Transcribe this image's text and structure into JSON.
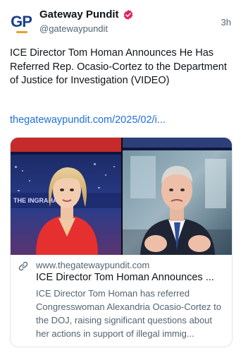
{
  "post": {
    "avatar_text": "GP",
    "display_name": "Gateway Pundit",
    "handle": "@gatewaypundit",
    "time": "3h",
    "text": "ICE Director Tom Homan Announces He Has Referred Rep. Ocasio-Cortez to the Department of Justice for Investigation (VIDEO)",
    "link": "thegatewaypundit.com/2025/02/i..."
  },
  "card": {
    "media_caption_left": "THE INGRAHAM",
    "domain": "www.thegatewaypundit.com",
    "title": "ICE Director Tom Homan Announces ...",
    "description": "ICE Director Tom Homan has referred Congresswoman Alexandria Ocasio-Cortez to the DOJ, raising significant questions about her actions in support of illegal immig..."
  },
  "colors": {
    "link": "#1d6fe0",
    "verified_badge": "#e0245e",
    "muted_text": "#536471"
  },
  "icons": {
    "verified": "verified-badge-icon",
    "link": "link-chain-icon"
  }
}
